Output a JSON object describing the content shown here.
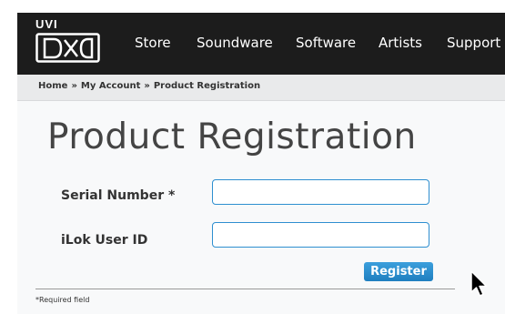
{
  "header": {
    "logo_text": "UVI",
    "nav": [
      {
        "label": "Store"
      },
      {
        "label": "Soundware"
      },
      {
        "label": "Software"
      },
      {
        "label": "Artists"
      },
      {
        "label": "Support"
      }
    ]
  },
  "breadcrumb": {
    "items": [
      "Home",
      "My Account",
      "Product Registration"
    ],
    "separator": "»"
  },
  "main": {
    "title": "Product Registration",
    "fields": [
      {
        "label": "Serial Number *",
        "value": "",
        "placeholder": ""
      },
      {
        "label": "iLok User ID",
        "value": "",
        "placeholder": ""
      }
    ],
    "register_label": "Register",
    "required_note": "*Required field"
  },
  "colors": {
    "header_bg": "#1c1c1c",
    "accent": "#2e8fd0",
    "page_bg": "#f8f9fa"
  },
  "icons": [
    "uvi-logo",
    "mouse-pointer-icon"
  ]
}
